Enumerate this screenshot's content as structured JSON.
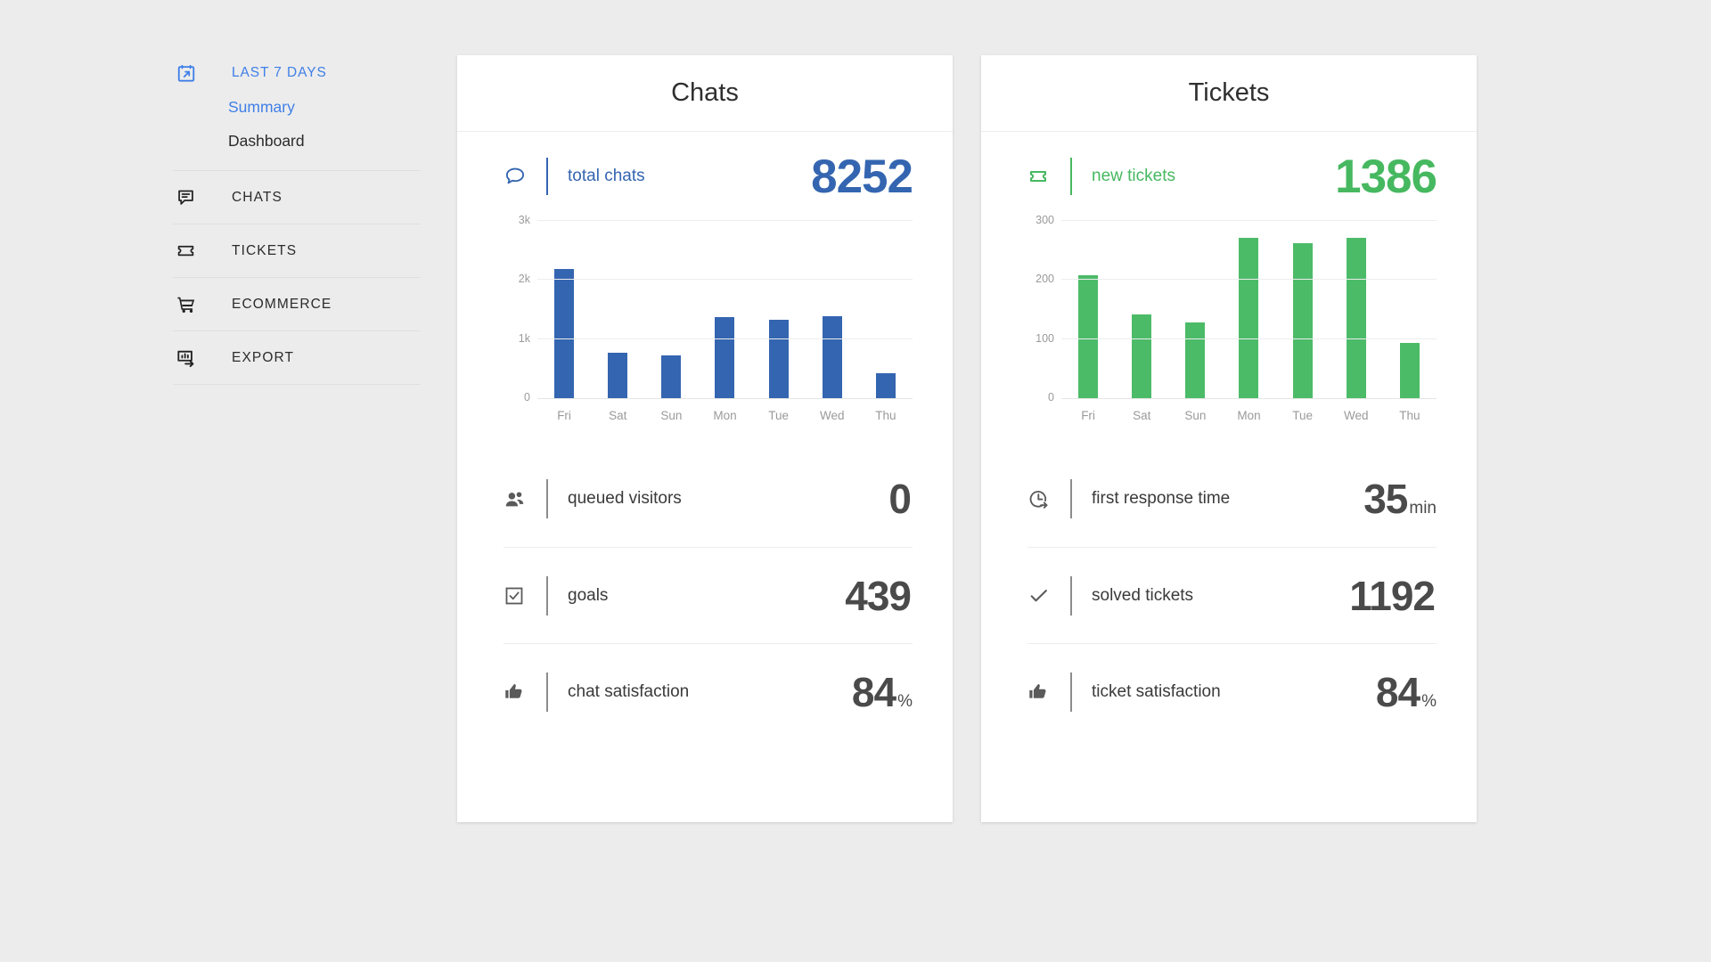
{
  "accent": {
    "blue": "#3465b0",
    "link_blue": "#3f7fe8",
    "green": "#46b860",
    "bar_green": "#4cbb68",
    "background": "#ececec"
  },
  "sidebar": {
    "date_range": {
      "label": "LAST 7 DAYS",
      "icon": "calendar-arrow-icon"
    },
    "subnav": [
      {
        "label": "Summary",
        "active": true
      },
      {
        "label": "Dashboard",
        "active": false
      }
    ],
    "items": [
      {
        "label": "CHATS",
        "icon": "chat-bubble-lines-icon"
      },
      {
        "label": "TICKETS",
        "icon": "ticket-icon"
      },
      {
        "label": "ECOMMERCE",
        "icon": "shopping-cart-icon"
      },
      {
        "label": "EXPORT",
        "icon": "chart-export-arrow-icon"
      }
    ]
  },
  "cards": [
    {
      "id": "chats",
      "title": "Chats",
      "accent": "blue",
      "headline": {
        "icon": "chat-bubble-icon",
        "label": "total chats",
        "value": "8252"
      },
      "metrics": [
        {
          "icon": "people-icon",
          "label": "queued visitors",
          "value": "0",
          "unit": ""
        },
        {
          "icon": "checkbox-icon",
          "label": "goals",
          "value": "439",
          "unit": ""
        },
        {
          "icon": "thumbs-up-icon",
          "label": "chat satisfaction",
          "value": "84",
          "unit": "%"
        }
      ]
    },
    {
      "id": "tickets",
      "title": "Tickets",
      "accent": "green",
      "headline": {
        "icon": "ticket-icon",
        "label": "new tickets",
        "value": "1386"
      },
      "metrics": [
        {
          "icon": "clock-arrow-icon",
          "label": "first response time",
          "value": "35",
          "unit": "min"
        },
        {
          "icon": "check-icon",
          "label": "solved tickets",
          "value": "1192",
          "unit": ""
        },
        {
          "icon": "thumbs-up-icon",
          "label": "ticket satisfaction",
          "value": "84",
          "unit": "%"
        }
      ]
    }
  ],
  "chart_data": [
    {
      "type": "bar",
      "title": "Chats",
      "series_name": "total chats",
      "categories": [
        "Fri",
        "Sat",
        "Sun",
        "Mon",
        "Tue",
        "Wed",
        "Thu"
      ],
      "values": [
        2180,
        775,
        730,
        1370,
        1330,
        1380,
        420
      ],
      "yticks": [
        0,
        1000,
        2000,
        3000
      ],
      "ytick_labels": [
        "0",
        "1k",
        "2k",
        "3k"
      ],
      "ylim": [
        0,
        3000
      ],
      "xlabel": "",
      "ylabel": "",
      "grid": true,
      "legend": "none",
      "color": "#3465b0"
    },
    {
      "type": "bar",
      "title": "Tickets",
      "series_name": "new tickets",
      "categories": [
        "Fri",
        "Sat",
        "Sun",
        "Mon",
        "Tue",
        "Wed",
        "Thu"
      ],
      "values": [
        208,
        142,
        128,
        272,
        263,
        271,
        93
      ],
      "yticks": [
        0,
        100,
        200,
        300
      ],
      "ytick_labels": [
        "0",
        "100",
        "200",
        "300"
      ],
      "ylim": [
        0,
        300
      ],
      "xlabel": "",
      "ylabel": "",
      "grid": true,
      "legend": "none",
      "color": "#4cbb68"
    }
  ]
}
